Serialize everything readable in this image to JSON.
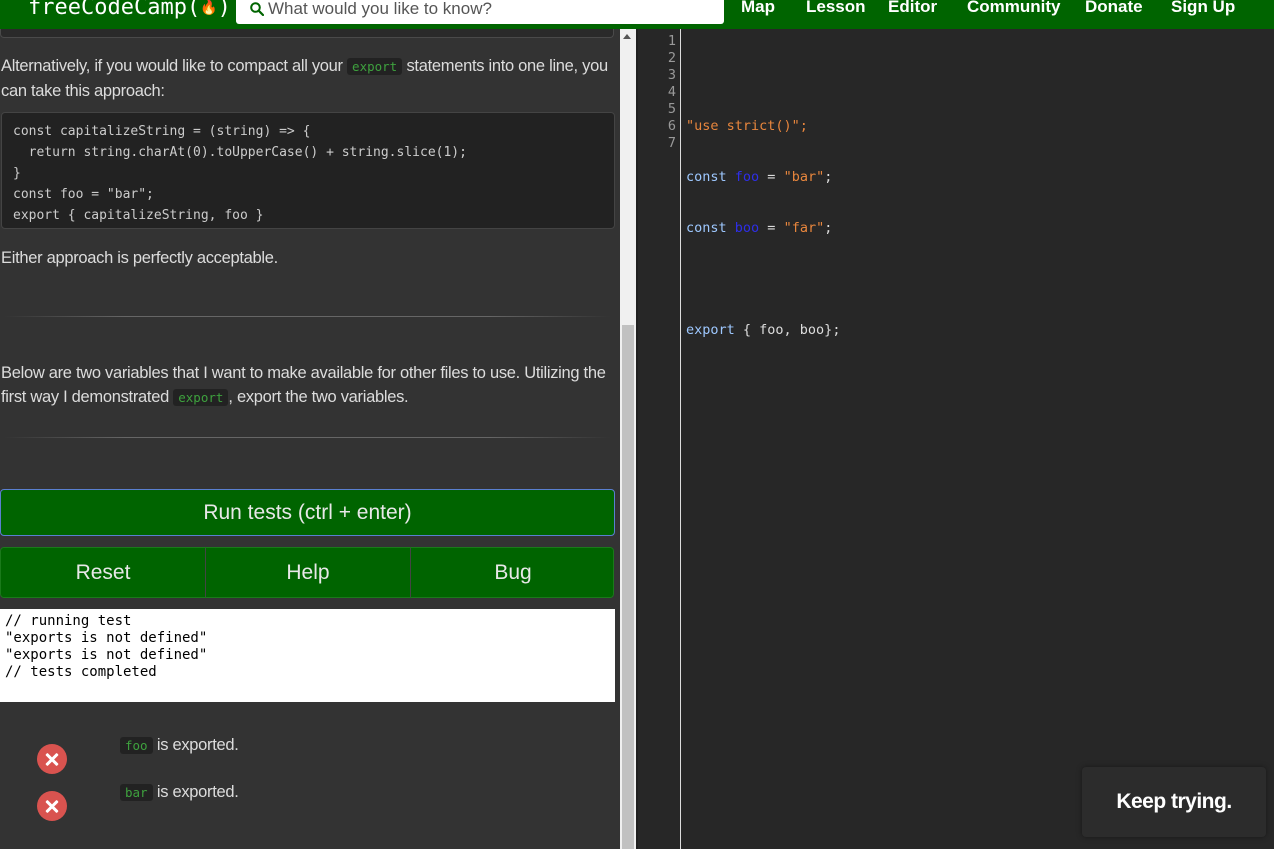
{
  "navbar": {
    "logo_text": "freeCodeCamp(",
    "logo_end": ")",
    "flame_icon": "flame-icon",
    "search_placeholder": "What would you like to know?",
    "links": [
      "Map",
      "Lesson",
      "Editor",
      "Community",
      "Donate",
      "Sign Up"
    ]
  },
  "lesson": {
    "para1_before": "Alternatively, if you would like to compact all your ",
    "para1_code": "export",
    "para1_after": " statements into one line, you can take this approach:",
    "code_block": "const capitalizeString = (string) => {\n  return string.charAt(0).toUpperCase() + string.slice(1);\n}\nconst foo = \"bar\";\nexport { capitalizeString, foo }",
    "para2": "Either approach is perfectly acceptable.",
    "para3_before": "Below are two variables that I want to make available for other files to use. Utilizing the first way I demonstrated ",
    "para3_code": "export",
    "para3_after": ", export the two variables."
  },
  "buttons": {
    "run": "Run tests (ctrl + enter)",
    "reset": "Reset",
    "help": "Help",
    "bug": "Bug"
  },
  "output": "// running test\n\"exports is not defined\"\n\"exports is not defined\"\n// tests completed",
  "tests": [
    {
      "code": "foo",
      "text": " is exported.",
      "status": "fail"
    },
    {
      "code": "bar",
      "text": " is exported.",
      "status": "fail"
    }
  ],
  "editor": {
    "line_numbers": [
      "1",
      "2",
      "3",
      "4",
      "5",
      "6",
      "7"
    ],
    "line2": "\"use strict()\";",
    "line3_kw": "const ",
    "line3_var": "foo",
    "line3_op": " = ",
    "line3_str": "\"bar\"",
    "line3_end": ";",
    "line4_kw": "const ",
    "line4_var": "boo",
    "line4_op": " = ",
    "line4_str": "\"far\"",
    "line4_end": ";",
    "line6_kw": "export",
    "line6_rest": " { foo, boo};"
  },
  "toast": "Keep trying.",
  "colors": {
    "brand_green": "#006400",
    "fail_red": "#d9534f",
    "inline_code": "#3ea13e"
  }
}
